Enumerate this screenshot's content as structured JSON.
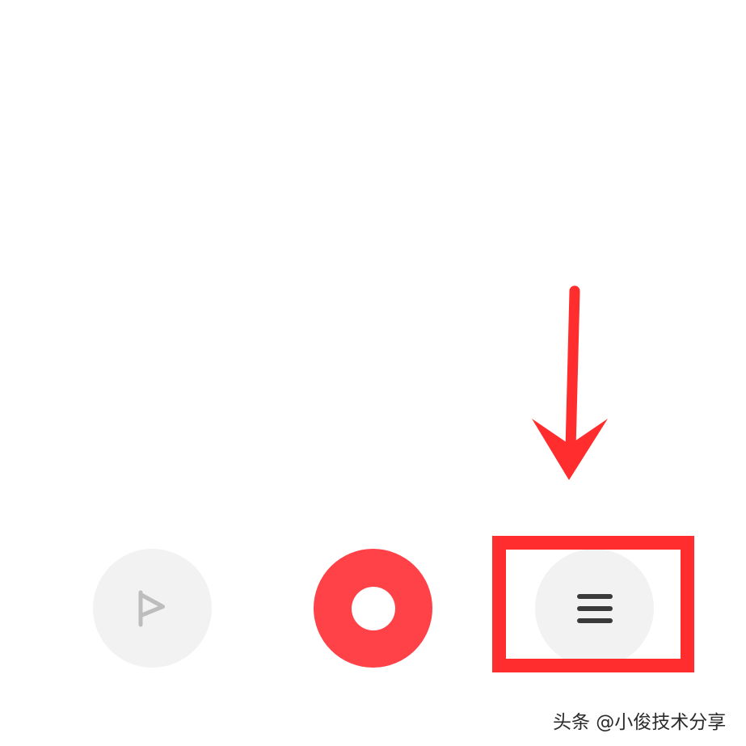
{
  "controls": {
    "flag": {
      "icon": "flag-icon"
    },
    "record": {
      "icon": "record-icon",
      "accent": "#ff4148"
    },
    "menu": {
      "icon": "menu-icon"
    }
  },
  "annotation": {
    "color": "#ff2d2d"
  },
  "watermark": {
    "text": "头条 @小俊技术分享"
  }
}
